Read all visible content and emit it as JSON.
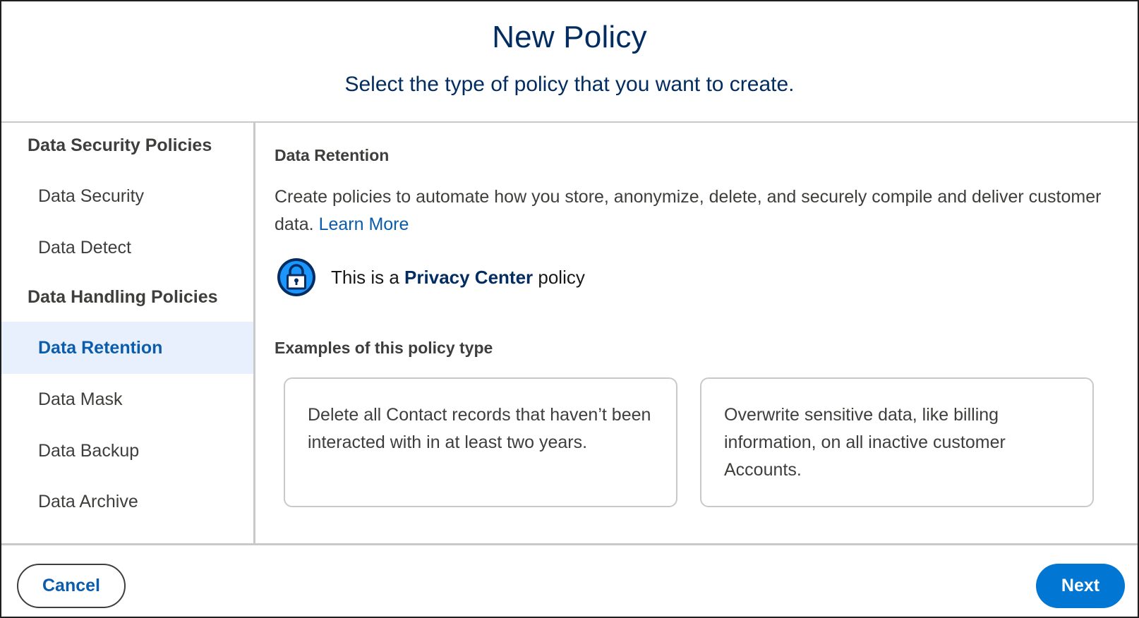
{
  "dialog": {
    "title": "New Policy",
    "subtitle": "Select the type of policy that you want to create."
  },
  "sidebar": {
    "groups": [
      {
        "heading": "Data Security Policies",
        "items": [
          "Data Security",
          "Data Detect"
        ]
      },
      {
        "heading": "Data Handling Policies",
        "items": [
          "Data Retention",
          "Data Mask",
          "Data Backup",
          "Data Archive"
        ]
      }
    ],
    "selected": "Data Retention"
  },
  "content": {
    "section_title": "Data Retention",
    "description": "Create policies to automate how you store, anonymize, delete, and securely compile and deliver customer data.",
    "learn_more": "Learn More",
    "privacy_prefix": "This is a",
    "privacy_bold": "Privacy Center",
    "privacy_suffix": "policy",
    "privacy_icon": "lock-icon",
    "examples_title": "Examples of this policy type",
    "examples": [
      "Delete all Contact records that haven’t been interacted with in at least two years.",
      "Overwrite sensitive data, like billing information, on all inactive customer Accounts."
    ]
  },
  "footer": {
    "cancel_label": "Cancel",
    "next_label": "Next"
  },
  "colors": {
    "brand_blue": "#0176d3",
    "link_blue": "#0b5cab",
    "title_navy": "#032d60",
    "selected_bg": "#e9f0fd"
  }
}
